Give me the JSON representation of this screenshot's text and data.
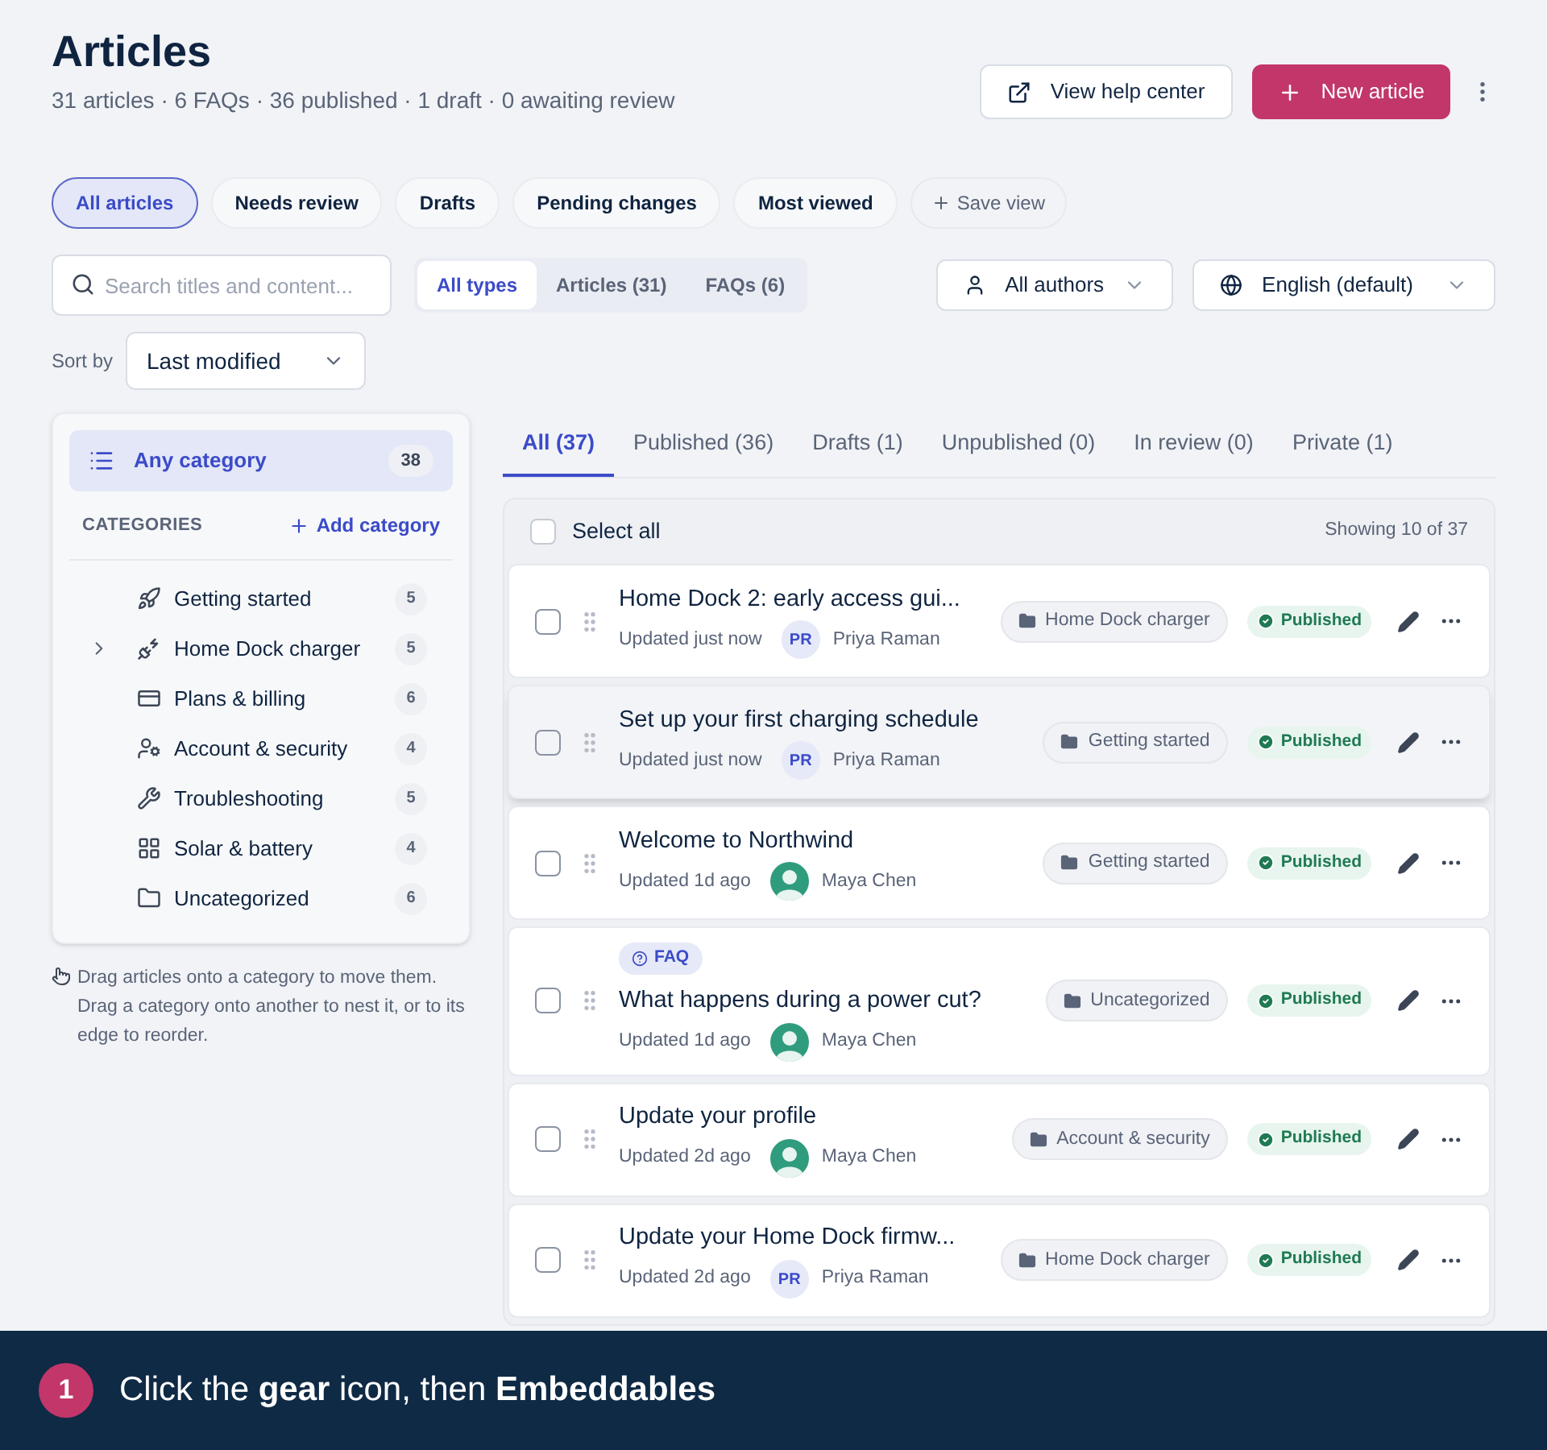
{
  "header": {
    "title": "Articles",
    "summary": "31 articles · 6 FAQs · 36 published · 1 draft · 0 awaiting review",
    "help_button": "View help center",
    "new_button": "New article"
  },
  "views": [
    {
      "label": "All articles",
      "selected": true
    },
    {
      "label": "Needs review",
      "selected": false
    },
    {
      "label": "Drafts",
      "selected": false
    },
    {
      "label": "Pending changes",
      "selected": false
    },
    {
      "label": "Most viewed",
      "selected": false
    }
  ],
  "save_view": "Save view",
  "search": {
    "placeholder": "Search titles and content..."
  },
  "types": [
    {
      "label": "All types",
      "selected": true
    },
    {
      "label": "Articles (31)",
      "selected": false
    },
    {
      "label": "FAQs (6)",
      "selected": false
    }
  ],
  "authors_filter": "All authors",
  "language_filter": "English (default)",
  "sort": {
    "label": "Sort by",
    "value": "Last modified"
  },
  "sidebar": {
    "any": {
      "label": "Any category",
      "count": "38",
      "selected": true
    },
    "heading": "CATEGORIES",
    "add": "Add category",
    "items": [
      {
        "label": "Getting started",
        "count": "5",
        "expandable": false
      },
      {
        "label": "Home Dock charger",
        "count": "5",
        "expandable": true
      },
      {
        "label": "Plans & billing",
        "count": "6",
        "expandable": false
      },
      {
        "label": "Account & security",
        "count": "4",
        "expandable": false
      },
      {
        "label": "Troubleshooting",
        "count": "5",
        "expandable": false
      },
      {
        "label": "Solar & battery",
        "count": "4",
        "expandable": false
      },
      {
        "label": "Uncategorized",
        "count": "6",
        "expandable": false
      }
    ],
    "hint": "Drag articles onto a category to move them. Drag a category onto another to nest it, or to its edge to reorder."
  },
  "status_tabs": [
    {
      "label": "All (37)",
      "selected": true
    },
    {
      "label": "Published (36)",
      "selected": false
    },
    {
      "label": "Drafts (1)",
      "selected": false
    },
    {
      "label": "Unpublished (0)",
      "selected": false
    },
    {
      "label": "In review (0)",
      "selected": false
    },
    {
      "label": "Private (1)",
      "selected": false
    }
  ],
  "list": {
    "select_all": "Select all",
    "all_checked": false,
    "showing": "Showing 10 of 37",
    "rows": [
      {
        "title": "Home Dock 2: early access gui...",
        "updated": "Updated just now",
        "avatar": {
          "kind": "initials",
          "text": "PR"
        },
        "author": "Priya Raman",
        "category": "Home Dock charger",
        "status": "Published",
        "highlighted": false
      },
      {
        "title": "Set up your first charging schedule",
        "updated": "Updated just now",
        "avatar": {
          "kind": "initials",
          "text": "PR"
        },
        "author": "Priya Raman",
        "category": "Getting started",
        "status": "Published",
        "highlighted": true
      },
      {
        "title": "Welcome to Northwind",
        "updated": "Updated 1d ago",
        "avatar": {
          "kind": "photo"
        },
        "author": "Maya Chen",
        "category": "Getting started",
        "status": "Published",
        "highlighted": false
      },
      {
        "badge": "FAQ",
        "title": "What happens during a power cut?",
        "updated": "Updated 1d ago",
        "avatar": {
          "kind": "photo"
        },
        "author": "Maya Chen",
        "category": "Uncategorized",
        "status": "Published",
        "highlighted": false
      },
      {
        "title": "Update your profile",
        "updated": "Updated 2d ago",
        "avatar": {
          "kind": "photo"
        },
        "author": "Maya Chen",
        "category": "Account & security",
        "status": "Published",
        "highlighted": false
      },
      {
        "title": "Update your Home Dock firmw...",
        "updated": "Updated 2d ago",
        "avatar": {
          "kind": "initials",
          "text": "PR"
        },
        "author": "Priya Raman",
        "category": "Home Dock charger",
        "status": "Published",
        "highlighted": false
      }
    ]
  },
  "tutorial": {
    "step": "1",
    "text": "Click the **gear** icon, then **Embeddables**"
  }
}
